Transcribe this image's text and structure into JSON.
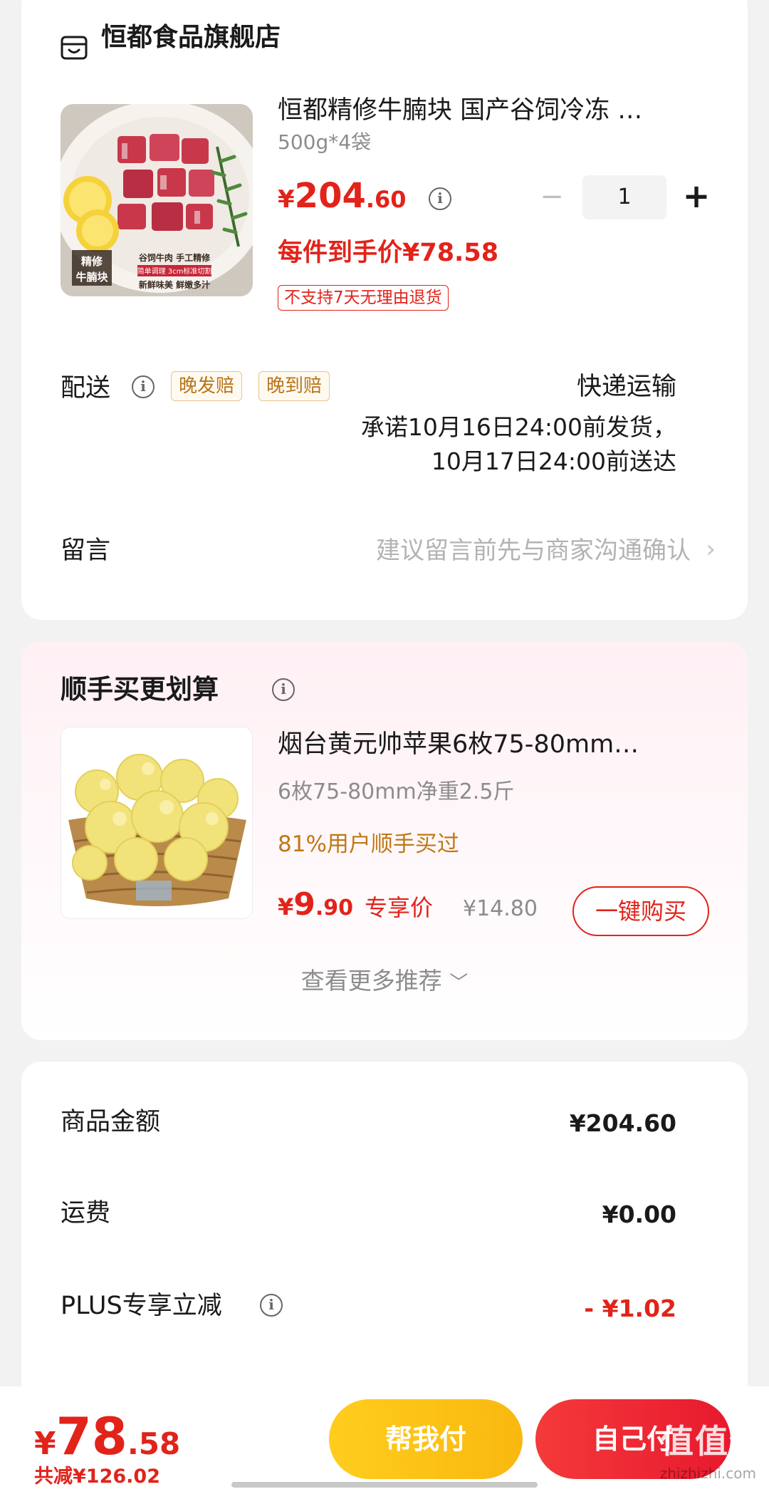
{
  "store": {
    "name": "恒都食品旗舰店"
  },
  "product": {
    "title": "恒都精修牛腩块 国产谷饲冷冻 …",
    "spec": "500g*4袋",
    "price_symbol": "¥",
    "price_int": "204",
    "price_dec": ".60",
    "quantity": "1",
    "minus_label": "−",
    "plus_label": "+",
    "unit_price": "每件到手价¥78.58",
    "no_return_tag": "不支持7天无理由退货",
    "image_text": {
      "left": "精修\n牛腩块",
      "line1": "谷饲牛肉 手工精修",
      "line2": "简单调理 3cm标准切割",
      "line3": "新鲜味美 鲜嫩多汁"
    }
  },
  "delivery": {
    "label": "配送",
    "tags": [
      "晚发赔",
      "晚到赔"
    ],
    "method": "快递运输",
    "promise": "承诺10月16日24:00前发货，10月17日24:00前送达"
  },
  "message": {
    "label": "留言",
    "placeholder": "建议留言前先与商家沟通确认"
  },
  "recommend": {
    "title": "顺手买更划算",
    "item": {
      "name": "烟台黄元帅苹果6枚75-80mm…",
      "spec": "6枚75-80mm净重2.5斤",
      "stat": "81%用户顺手买过",
      "price_symbol": "¥",
      "price_int": "9",
      "price_dec": ".90",
      "exclusive": "专享价",
      "original": "¥14.80",
      "buy_label": "一键购买"
    },
    "more": "查看更多推荐"
  },
  "summary": {
    "rows": [
      {
        "label": "商品金额",
        "value": "¥204.60"
      },
      {
        "label": "运费",
        "value": "¥0.00"
      },
      {
        "label": "PLUS专享立减",
        "value": "- ¥1.02"
      }
    ]
  },
  "bottom": {
    "total_symbol": "¥",
    "total_int": "78",
    "total_dec": ".58",
    "saved": "共减¥126.02",
    "help_pay": "帮我付",
    "self_pay": "自己付",
    "watermark": "值值值",
    "watermark_sub": "zhizhizhi.com"
  },
  "colors": {
    "accent_red": "#e2231a",
    "gold": "#b8741a",
    "help_yellow": "#ffcd1e"
  },
  "icons": [
    "store-icon",
    "info-icon",
    "chevron-right-icon",
    "chevron-down-icon"
  ]
}
